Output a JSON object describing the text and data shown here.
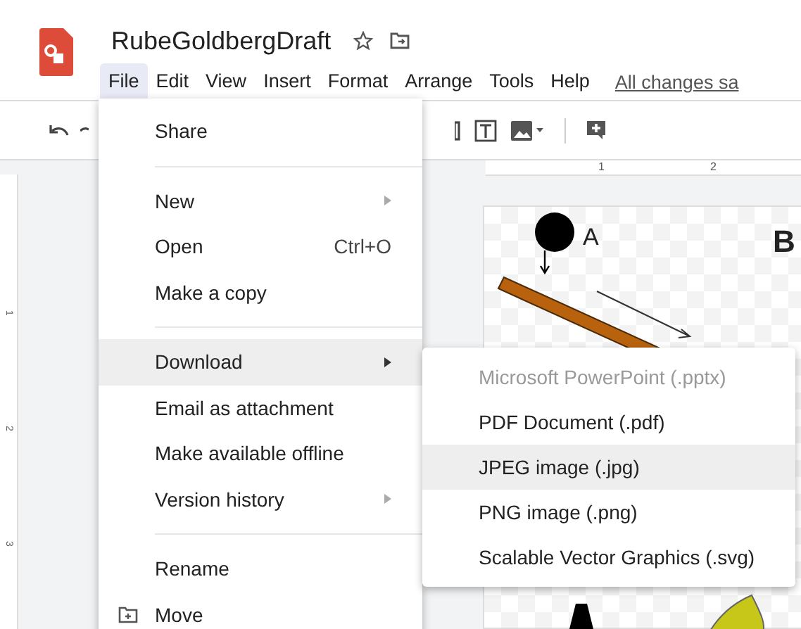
{
  "document": {
    "title": "RubeGoldbergDraft",
    "save_status": "All changes sa"
  },
  "menu_bar": [
    {
      "label": "File",
      "selected": true
    },
    {
      "label": "Edit",
      "selected": false
    },
    {
      "label": "View",
      "selected": false
    },
    {
      "label": "Insert",
      "selected": false
    },
    {
      "label": "Format",
      "selected": false
    },
    {
      "label": "Arrange",
      "selected": false
    },
    {
      "label": "Tools",
      "selected": false
    },
    {
      "label": "Help",
      "selected": false
    }
  ],
  "ruler": {
    "marks": [
      "1",
      "2"
    ],
    "side_marks": [
      "1",
      "2",
      "3"
    ]
  },
  "slide": {
    "labels": [
      "A",
      "B"
    ]
  },
  "file_menu": [
    {
      "kind": "item",
      "label": "Share",
      "selected": false
    },
    {
      "kind": "separator"
    },
    {
      "kind": "item",
      "label": "New",
      "submenu": true,
      "selected": false
    },
    {
      "kind": "item",
      "label": "Open",
      "shortcut": "Ctrl+O",
      "selected": false
    },
    {
      "kind": "item",
      "label": "Make a copy",
      "selected": false
    },
    {
      "kind": "separator"
    },
    {
      "kind": "item",
      "label": "Download",
      "submenu": true,
      "selected": true
    },
    {
      "kind": "item",
      "label": "Email as attachment",
      "selected": false
    },
    {
      "kind": "item",
      "label": "Make available offline",
      "selected": false
    },
    {
      "kind": "item",
      "label": "Version history",
      "submenu": true,
      "selected": false
    },
    {
      "kind": "separator"
    },
    {
      "kind": "item",
      "label": "Rename",
      "selected": false
    },
    {
      "kind": "icon_item",
      "label": "Move",
      "selected": false
    }
  ],
  "download_menu": [
    {
      "label": "Microsoft PowerPoint (.pptx)",
      "disabled": true,
      "selected": false
    },
    {
      "label": "PDF Document (.pdf)",
      "disabled": false,
      "selected": false
    },
    {
      "label": "JPEG image (.jpg)",
      "disabled": false,
      "selected": true
    },
    {
      "label": "PNG image (.png)",
      "disabled": false,
      "selected": false
    },
    {
      "label": "Scalable Vector Graphics (.svg)",
      "disabled": false,
      "selected": false
    }
  ]
}
